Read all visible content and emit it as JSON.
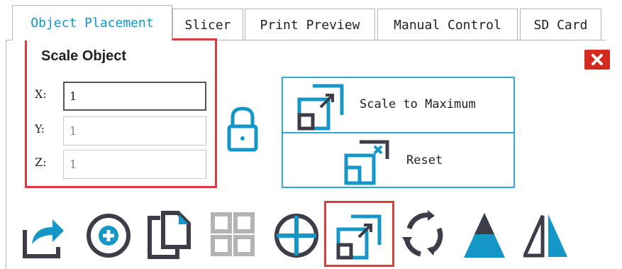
{
  "tabs": [
    {
      "label": "Object Placement",
      "active": true
    },
    {
      "label": "Slicer",
      "active": false
    },
    {
      "label": "Print Preview",
      "active": false
    },
    {
      "label": "Manual Control",
      "active": false
    },
    {
      "label": "SD Card",
      "active": false
    }
  ],
  "scale": {
    "title": "Scale Object",
    "x_label": "X:",
    "y_label": "Y:",
    "z_label": "Z:",
    "x_value": "1",
    "y_value": "1",
    "z_value": "1"
  },
  "actions": {
    "scale_max_label": "Scale to Maximum",
    "reset_label": "Reset"
  },
  "toolbar": [
    "export-icon",
    "add-object-icon",
    "copy-icon",
    "grid-arrange-icon",
    "center-object-icon",
    "scale-icon",
    "rotate-icon",
    "cut-icon",
    "mirror-icon"
  ],
  "colors": {
    "accent": "#1497c6",
    "highlight": "#e03a3a",
    "icon_dark": "#3d3d48",
    "icon_disabled": "#b3b3b3",
    "close_bg": "#d42a20"
  }
}
